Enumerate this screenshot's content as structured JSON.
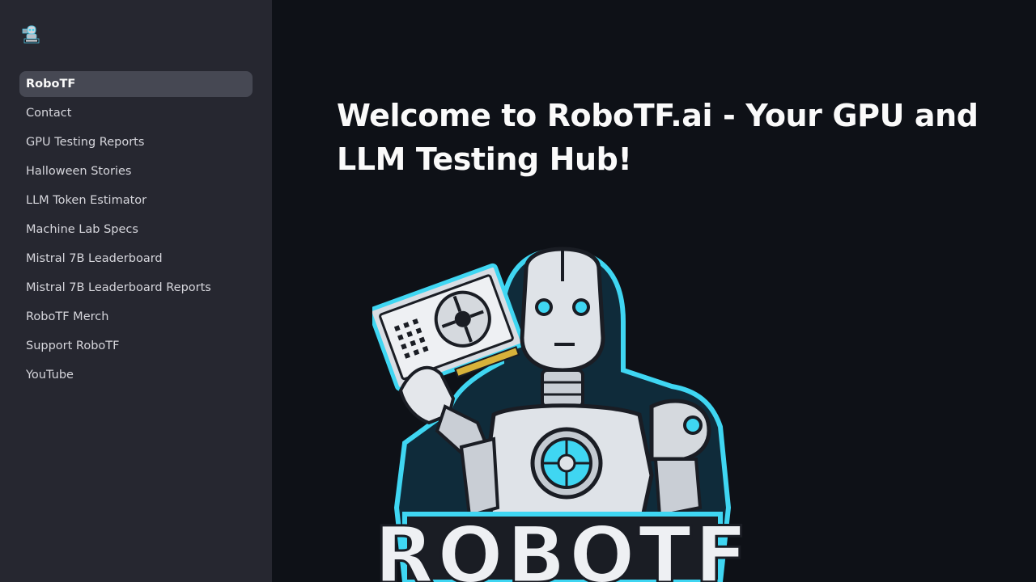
{
  "sidebar": {
    "logo_alt": "RoboTF logo",
    "items": [
      {
        "label": "RoboTF",
        "active": true
      },
      {
        "label": "Contact"
      },
      {
        "label": "GPU Testing Reports"
      },
      {
        "label": "Halloween Stories"
      },
      {
        "label": "LLM Token Estimator"
      },
      {
        "label": "Machine Lab Specs"
      },
      {
        "label": "Mistral 7B Leaderboard"
      },
      {
        "label": "Mistral 7B Leaderboard Reports"
      },
      {
        "label": "RoboTF Merch"
      },
      {
        "label": "Support RoboTF"
      },
      {
        "label": "YouTube"
      }
    ]
  },
  "main": {
    "title": "Welcome to RoboTF.ai - Your GPU and LLM Testing Hub!",
    "hero_logo_text": "ROBOTF"
  },
  "colors": {
    "background": "#0e1117",
    "sidebar": "#262730",
    "active_item": "#464853",
    "accent_glow": "#3fd6f2"
  }
}
